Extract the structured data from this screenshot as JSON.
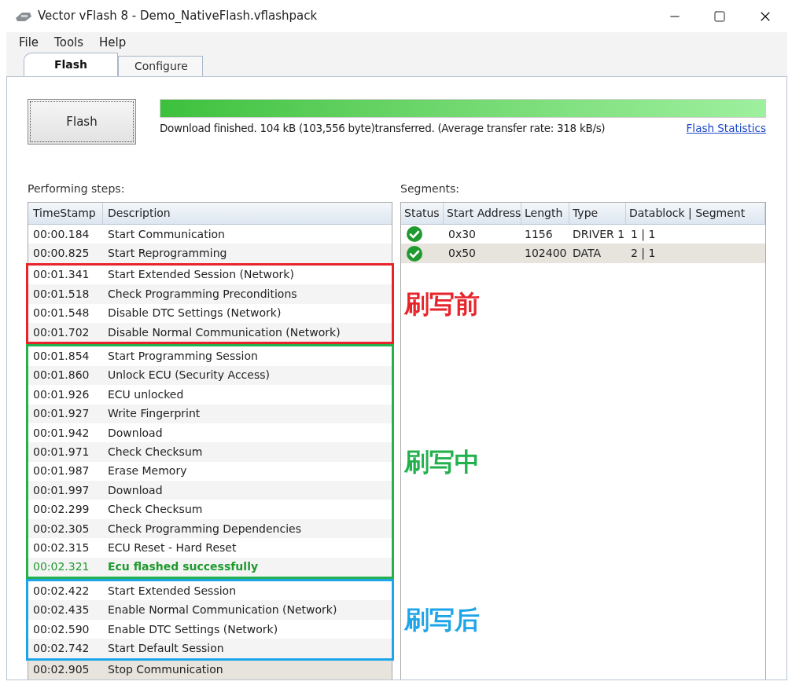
{
  "window": {
    "title": "Vector vFlash 8 - Demo_NativeFlash.vflashpack"
  },
  "menu": [
    "File",
    "Tools",
    "Help"
  ],
  "tabs": [
    {
      "label": "Flash",
      "selected": true
    },
    {
      "label": "Configure",
      "selected": false
    }
  ],
  "flash_button": "Flash",
  "progress": {
    "level": 1,
    "message": "Download finished. 104 kB (103,556 byte)transferred. (Average transfer rate: 318 kB/s)",
    "link": "Flash Statistics"
  },
  "steps": {
    "label": "Performing steps:",
    "columns": [
      "TimeStamp",
      "Description"
    ],
    "groups": [
      {
        "rows": [
          {
            "time": "00:00.184",
            "description": "Start Communication",
            "kind": "plain",
            "selected": false
          },
          {
            "time": "00:00.825",
            "description": "Start Reprogramming",
            "kind": "plain",
            "selected": false
          }
        ]
      },
      {
        "annotation": {
          "label": "刷写前",
          "color": "#e8242b"
        },
        "rows": [
          {
            "time": "00:01.341",
            "description": "Start Extended Session (Network)",
            "kind": "plain",
            "selected": false
          },
          {
            "time": "00:01.518",
            "description": "Check Programming Preconditions",
            "kind": "plain",
            "selected": false
          },
          {
            "time": "00:01.548",
            "description": "Disable DTC Settings (Network)",
            "kind": "plain",
            "selected": false
          },
          {
            "time": "00:01.702",
            "description": "Disable Normal Communication (Network)",
            "kind": "plain",
            "selected": false
          }
        ]
      },
      {
        "annotation": {
          "label": "刷写中",
          "color": "#22b14c"
        },
        "rows": [
          {
            "time": "00:01.854",
            "description": "Start Programming Session",
            "kind": "plain",
            "selected": false
          },
          {
            "time": "00:01.860",
            "description": "Unlock ECU (Security Access)",
            "kind": "plain",
            "selected": false
          },
          {
            "time": "00:01.926",
            "description": "ECU unlocked",
            "kind": "plain",
            "selected": false
          },
          {
            "time": "00:01.927",
            "description": "Write Fingerprint",
            "kind": "plain",
            "selected": false
          },
          {
            "time": "00:01.942",
            "description": "Download",
            "kind": "plain",
            "selected": false
          },
          {
            "time": "00:01.971",
            "description": "Check Checksum",
            "kind": "plain",
            "selected": false
          },
          {
            "time": "00:01.987",
            "description": "Erase Memory",
            "kind": "plain",
            "selected": false
          },
          {
            "time": "00:01.997",
            "description": "Download",
            "kind": "plain",
            "selected": false
          },
          {
            "time": "00:02.299",
            "description": "Check Checksum",
            "kind": "plain",
            "selected": false
          },
          {
            "time": "00:02.305",
            "description": "Check Programming Dependencies",
            "kind": "plain",
            "selected": false
          },
          {
            "time": "00:02.315",
            "description": "ECU Reset - Hard Reset",
            "kind": "plain",
            "selected": false
          },
          {
            "time": "00:02.321",
            "description": "Ecu flashed successfully",
            "kind": "success",
            "selected": false
          }
        ]
      },
      {
        "annotation": {
          "label": "刷写后",
          "color": "#1ea5e8"
        },
        "rows": [
          {
            "time": "00:02.422",
            "description": "Start Extended Session",
            "kind": "plain",
            "selected": false
          },
          {
            "time": "00:02.435",
            "description": "Enable Normal Communication (Network)",
            "kind": "plain",
            "selected": false
          },
          {
            "time": "00:02.590",
            "description": "Enable DTC Settings (Network)",
            "kind": "plain",
            "selected": false
          },
          {
            "time": "00:02.742",
            "description": "Start Default Session",
            "kind": "plain",
            "selected": false
          }
        ]
      },
      {
        "rows": [
          {
            "time": "00:02.905",
            "description": "Stop Communication",
            "kind": "plain",
            "selected": true
          }
        ]
      }
    ]
  },
  "segments": {
    "label": "Segments:",
    "columns": [
      "Status",
      "Start Address",
      "Length",
      "Type",
      "Datablock | Segment"
    ],
    "rows": [
      {
        "completed": true,
        "address": "0x30",
        "length": "1156",
        "type": "DRIVER 1",
        "block": "1 | 1",
        "selected": false
      },
      {
        "completed": true,
        "address": "0x50",
        "length": "102400",
        "type": "DATA",
        "block": "2 | 1",
        "selected": true
      }
    ]
  }
}
